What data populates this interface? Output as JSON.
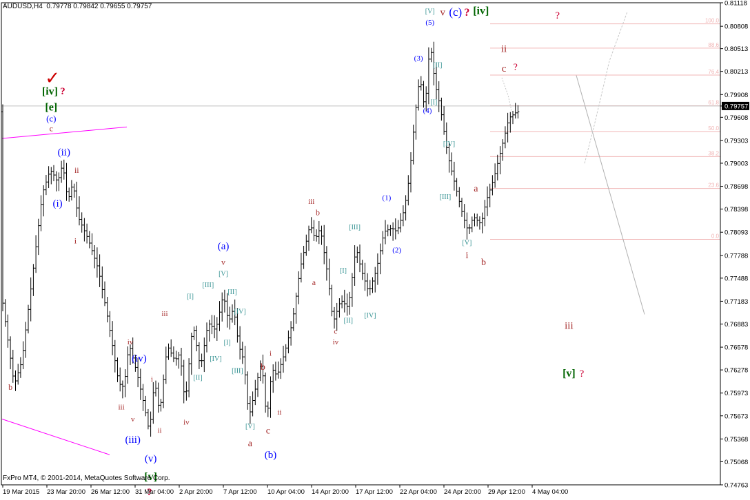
{
  "header": {
    "symbol": "AUDUSD,H4",
    "open": "0.79778",
    "high": "0.79842",
    "low": "0.79655",
    "close": "0.79757"
  },
  "footer": {
    "copyright": "FxPro MT4, © 2001-2014, MetaQuotes Software Corp."
  },
  "colors": {
    "background": "#ffffff",
    "candles": "#000000",
    "wave_red": "#a52a2a",
    "wave_blue": "#0000ff",
    "wave_teal": "#2f8f8f",
    "wave_green": "#006400",
    "question": "#cc0033",
    "channel": "#ff00ff",
    "fib": "#f0b4b4",
    "current_price_line": "#c0c0c0"
  },
  "chart_data": {
    "type": "candlestick",
    "timeframe": "H4",
    "ylim": [
      0.74763,
      0.81118
    ],
    "y_tick_labels": [
      "0.81118",
      "0.80808",
      "0.80513",
      "0.80213",
      "0.79908",
      "0.79757",
      "0.79608",
      "0.79303",
      "0.79003",
      "0.78698",
      "0.78398",
      "0.78093",
      "0.77788",
      "0.77488",
      "0.77183",
      "0.76883",
      "0.76578",
      "0.76278",
      "0.75973",
      "0.75673",
      "0.75368",
      "0.75068",
      "0.74763"
    ],
    "current_price": "0.79757",
    "x_tick_labels": [
      "19 Mar 2015",
      "23 Mar 20:00",
      "26 Mar 12:00",
      "31 Mar 04:00",
      "2 Apr 20:00",
      "7 Apr 12:00",
      "10 Apr 04:00",
      "14 Apr 20:00",
      "17 Apr 12:00",
      "22 Apr 04:00",
      "24 Apr 20:00",
      "29 Apr 12:00",
      "4 May 04:00"
    ],
    "fibonacci": [
      {
        "label": "100.0",
        "price": 0.8084
      },
      {
        "label": "88.6",
        "price": 0.8052
      },
      {
        "label": "76.4",
        "price": 0.80165
      },
      {
        "label": "61.8",
        "price": 0.7976
      },
      {
        "label": "50.0",
        "price": 0.7942
      },
      {
        "label": "38.2",
        "price": 0.7909
      },
      {
        "label": "23.6",
        "price": 0.7867
      },
      {
        "label": "0.0",
        "price": 0.78
      }
    ],
    "annotations": [
      {
        "text": "✓",
        "color": "#cc0000",
        "price": 0.801,
        "bar": 19.5,
        "size": 26
      },
      {
        "text": "[iv]",
        "color": "#006400",
        "price": 0.7994,
        "bar": 18.5,
        "size": 16,
        "bold": true
      },
      {
        "text": "?",
        "color": "#cc0033",
        "price": 0.7994,
        "bar": 23.5,
        "size": 15,
        "bold": true
      },
      {
        "text": "[e]",
        "color": "#006400",
        "price": 0.7973,
        "bar": 19.0,
        "size": 16,
        "bold": true
      },
      {
        "text": "(c)",
        "color": "#0000ff",
        "price": 0.7958,
        "bar": 19.0,
        "size": 13
      },
      {
        "text": "c",
        "color": "#a52a2a",
        "price": 0.7945,
        "bar": 19.0,
        "size": 12
      },
      {
        "text": "(ii)",
        "color": "#0000ff",
        "price": 0.7914,
        "bar": 24.0,
        "size": 15
      },
      {
        "text": "ii",
        "color": "#a52a2a",
        "price": 0.789,
        "bar": 29.0,
        "size": 12
      },
      {
        "text": "(i)",
        "color": "#0000ff",
        "price": 0.7846,
        "bar": 21.5,
        "size": 15
      },
      {
        "text": "i",
        "color": "#a52a2a",
        "price": 0.7797,
        "bar": 28.5,
        "size": 12
      },
      {
        "text": "b",
        "color": "#a52a2a",
        "price": 0.7604,
        "bar": 3.0,
        "size": 12
      },
      {
        "text": "iv",
        "color": "#a52a2a",
        "price": 0.7664,
        "bar": 50.0,
        "size": 11
      },
      {
        "text": "(iv)",
        "color": "#0000ff",
        "price": 0.7642,
        "bar": 53.5,
        "size": 15
      },
      {
        "text": "iii",
        "color": "#a52a2a",
        "price": 0.7578,
        "bar": 46.5,
        "size": 11
      },
      {
        "text": "v",
        "color": "#a52a2a",
        "price": 0.7562,
        "bar": 51.0,
        "size": 11
      },
      {
        "text": "(iii)",
        "color": "#0000ff",
        "price": 0.7535,
        "bar": 51.0,
        "size": 15
      },
      {
        "text": "i",
        "color": "#a52a2a",
        "price": 0.7615,
        "bar": 58.5,
        "size": 11
      },
      {
        "text": "ii",
        "color": "#a52a2a",
        "price": 0.7547,
        "bar": 61.5,
        "size": 11
      },
      {
        "text": "(v)",
        "color": "#0000ff",
        "price": 0.751,
        "bar": 58.0,
        "size": 15
      },
      {
        "text": "[v]",
        "color": "#006400",
        "price": 0.7486,
        "bar": 58.0,
        "size": 16,
        "bold": true
      },
      {
        "text": "?",
        "color": "#cc0033",
        "price": 0.7466,
        "bar": 57.5,
        "size": 15,
        "bold": true
      },
      {
        "text": "iii",
        "color": "#a52a2a",
        "price": 0.7701,
        "bar": 63.5,
        "size": 11
      },
      {
        "text": "iv",
        "color": "#a52a2a",
        "price": 0.7558,
        "bar": 72.0,
        "size": 11
      },
      {
        "text": "[I]",
        "color": "#2f8f8f",
        "price": 0.7724,
        "bar": 73.5,
        "size": 10
      },
      {
        "text": "[III]",
        "color": "#2f8f8f",
        "price": 0.7739,
        "bar": 80.5,
        "size": 10
      },
      {
        "text": "[II]",
        "color": "#2f8f8f",
        "price": 0.7617,
        "bar": 76.5,
        "size": 10
      },
      {
        "text": "[IV]",
        "color": "#2f8f8f",
        "price": 0.7642,
        "bar": 83.5,
        "size": 10
      },
      {
        "text": "[I]",
        "color": "#2f8f8f",
        "price": 0.7663,
        "bar": 88.0,
        "size": 10
      },
      {
        "text": "[V]",
        "color": "#2f8f8f",
        "price": 0.7754,
        "bar": 86.5,
        "size": 10
      },
      {
        "text": "[II]",
        "color": "#2f8f8f",
        "price": 0.773,
        "bar": 90.0,
        "size": 10
      },
      {
        "text": "[IV]",
        "color": "#2f8f8f",
        "price": 0.7704,
        "bar": 93.0,
        "size": 10
      },
      {
        "text": "[III]",
        "color": "#2f8f8f",
        "price": 0.7626,
        "bar": 92.0,
        "size": 10
      },
      {
        "text": "v",
        "color": "#a52a2a",
        "price": 0.7769,
        "bar": 86.5,
        "size": 12
      },
      {
        "text": "(a)",
        "color": "#0000ff",
        "price": 0.779,
        "bar": 86.5,
        "size": 15
      },
      {
        "text": "[V]",
        "color": "#2f8f8f",
        "price": 0.7553,
        "bar": 97.0,
        "size": 10
      },
      {
        "text": "a",
        "color": "#a52a2a",
        "price": 0.753,
        "bar": 97.0,
        "size": 14
      },
      {
        "text": "b",
        "color": "#a52a2a",
        "price": 0.7631,
        "bar": 102.0,
        "size": 14
      },
      {
        "text": "i",
        "color": "#a52a2a",
        "price": 0.7649,
        "bar": 105.0,
        "size": 11
      },
      {
        "text": "c",
        "color": "#a52a2a",
        "price": 0.7547,
        "bar": 104.0,
        "size": 14
      },
      {
        "text": "ii",
        "color": "#a52a2a",
        "price": 0.7571,
        "bar": 108.5,
        "size": 11
      },
      {
        "text": "(b)",
        "color": "#0000ff",
        "price": 0.7515,
        "bar": 105.0,
        "size": 15
      },
      {
        "text": "iii",
        "color": "#a52a2a",
        "price": 0.7849,
        "bar": 121.0,
        "size": 11
      },
      {
        "text": "b",
        "color": "#a52a2a",
        "price": 0.7834,
        "bar": 123.5,
        "size": 12
      },
      {
        "text": "a",
        "color": "#a52a2a",
        "price": 0.7742,
        "bar": 122.0,
        "size": 12
      },
      {
        "text": "c",
        "color": "#a52a2a",
        "price": 0.7678,
        "bar": 130.5,
        "size": 11
      },
      {
        "text": "iv",
        "color": "#a52a2a",
        "price": 0.7664,
        "bar": 130.5,
        "size": 11
      },
      {
        "text": "[I]",
        "color": "#2f8f8f",
        "price": 0.7758,
        "bar": 133.5,
        "size": 10
      },
      {
        "text": "[III]",
        "color": "#2f8f8f",
        "price": 0.7815,
        "bar": 138.0,
        "size": 10
      },
      {
        "text": "[II]",
        "color": "#2f8f8f",
        "price": 0.7692,
        "bar": 135.5,
        "size": 10
      },
      {
        "text": "[IV]",
        "color": "#2f8f8f",
        "price": 0.7699,
        "bar": 144.0,
        "size": 10
      },
      {
        "text": "(1)",
        "color": "#0000ff",
        "price": 0.7854,
        "bar": 150.5,
        "size": 11
      },
      {
        "text": "(2)",
        "color": "#0000ff",
        "price": 0.7785,
        "bar": 154.5,
        "size": 11
      },
      {
        "text": "(3)",
        "color": "#0000ff",
        "price": 0.8038,
        "bar": 163.0,
        "size": 11
      },
      {
        "text": "[V]",
        "color": "#2f8f8f",
        "price": 0.81,
        "bar": 167.5,
        "size": 10
      },
      {
        "text": "(5)",
        "color": "#0000ff",
        "price": 0.8085,
        "bar": 167.5,
        "size": 11
      },
      {
        "text": "v",
        "color": "#a52a2a",
        "price": 0.8098,
        "bar": 172.5,
        "size": 15
      },
      {
        "text": "(c)",
        "color": "#0000ff",
        "price": 0.8098,
        "bar": 177.5,
        "size": 17
      },
      {
        "text": "?",
        "color": "#cc0033",
        "price": 0.8098,
        "bar": 182.0,
        "size": 16,
        "bold": true
      },
      {
        "text": "[iv]",
        "color": "#006400",
        "price": 0.81,
        "bar": 187.5,
        "size": 16,
        "bold": true
      },
      {
        "text": "[II]",
        "color": "#2f8f8f",
        "price": 0.8029,
        "bar": 170.5,
        "size": 10
      },
      {
        "text": "[I]",
        "color": "#2f8f8f",
        "price": 0.798,
        "bar": 169.0,
        "size": 10
      },
      {
        "text": "(4)",
        "color": "#0000ff",
        "price": 0.7969,
        "bar": 166.5,
        "size": 11
      },
      {
        "text": "[IV]",
        "color": "#2f8f8f",
        "price": 0.7925,
        "bar": 175.0,
        "size": 10
      },
      {
        "text": "[III]",
        "color": "#2f8f8f",
        "price": 0.7855,
        "bar": 173.5,
        "size": 10
      },
      {
        "text": "[V]",
        "color": "#2f8f8f",
        "price": 0.7795,
        "bar": 182.0,
        "size": 10
      },
      {
        "text": "i",
        "color": "#a52a2a",
        "price": 0.7778,
        "bar": 182.0,
        "size": 14
      },
      {
        "text": "a",
        "color": "#a52a2a",
        "price": 0.7866,
        "bar": 185.5,
        "size": 14
      },
      {
        "text": "b",
        "color": "#a52a2a",
        "price": 0.7769,
        "bar": 188.5,
        "size": 14
      },
      {
        "text": "ii",
        "color": "#a52a2a",
        "price": 0.805,
        "bar": 196.5,
        "size": 15
      },
      {
        "text": "c",
        "color": "#a52a2a",
        "price": 0.8024,
        "bar": 196.5,
        "size": 15
      },
      {
        "text": "?",
        "color": "#cc0033",
        "price": 0.8026,
        "bar": 201.0,
        "size": 14
      },
      {
        "text": "?",
        "color": "#cc0033",
        "price": 0.8094,
        "bar": 217.5,
        "size": 15
      },
      {
        "text": "iii",
        "color": "#a52a2a",
        "price": 0.7685,
        "bar": 222.0,
        "size": 15
      },
      {
        "text": "[v]",
        "color": "#006400",
        "price": 0.7622,
        "bar": 222.0,
        "size": 16,
        "bold": true
      },
      {
        "text": "?",
        "color": "#cc0033",
        "price": 0.7622,
        "bar": 227.0,
        "size": 15
      }
    ]
  }
}
